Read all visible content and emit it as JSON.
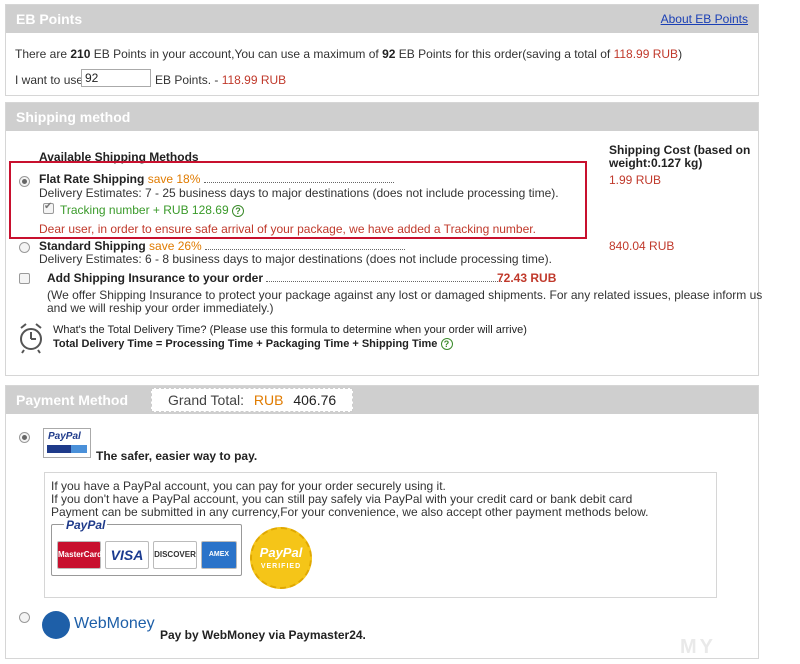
{
  "eb_points": {
    "title": "EB Points",
    "about_link": "About EB Points",
    "info_prefix": "There are ",
    "available": "210",
    "info_mid": " EB Points in your account,You can use a maximum of ",
    "max_use": "92",
    "info_mid2": " EB Points for this order(saving a total of ",
    "saving": "118.99 RUB",
    "info_end": ")",
    "use_label": "I want to use",
    "use_value": "92",
    "use_suffix": "EB Points. -",
    "use_discount": "118.99 RUB"
  },
  "shipping": {
    "title": "Shipping method",
    "col_methods": "Available Shipping Methods",
    "col_cost_1": "Shipping Cost (based on",
    "col_cost_2": "weight:0.127 kg)",
    "flat": {
      "name": "Flat Rate Shipping",
      "save": "save 18%",
      "estimate": "Delivery Estimates: 7 - 25 business days to major destinations (does not include processing time).",
      "tracking": "Tracking number + RUB 128.69",
      "notice": "Dear user, in order to ensure safe arrival of your package, we have added a Tracking number.",
      "cost": "1.99 RUB"
    },
    "standard": {
      "name": "Standard Shipping",
      "save": "save 26%",
      "estimate": "Delivery Estimates: 6 - 8 business days to major destinations (does not include processing time).",
      "cost": "840.04 RUB"
    },
    "insurance": {
      "label": "Add Shipping Insurance to your order",
      "cost": "72.43 RUB",
      "desc_1": "(We offer Shipping Insurance to protect your package against any lost or damaged shipments. For any related issues, please inform us",
      "desc_2": "and we will reship your order immediately.)"
    },
    "delivery_q": "What's the Total Delivery Time? (Please use this formula to determine when your order will arrive)",
    "delivery_formula": "Total Delivery Time = Processing Time + Packaging Time + Shipping Time"
  },
  "payment": {
    "title": "Payment Method",
    "grand_label": "Grand Total:",
    "grand_currency": "RUB",
    "grand_value": "406.76",
    "paypal_logo": "PayPal",
    "paypal_tagline": "The safer, easier way to pay.",
    "paypal_info_1": "If you have a PayPal account, you can pay for your order securely using it.",
    "paypal_info_2": "If you don't have a PayPal account, you can still pay safely via PayPal with your credit card or bank debit card",
    "paypal_info_3": "Payment can be submitted in any currency,For your convenience, we also accept other payment methods below.",
    "cards_label": "PayPal",
    "card_mastercard": "MasterCard",
    "card_visa": "VISA",
    "card_discover": "DISCOVER",
    "card_amex": "AMEX",
    "seal_top": "PayPal",
    "seal_bottom": "VERIFIED",
    "webmoney_logo": "WebMoney",
    "webmoney_desc": "Pay by WebMoney via Paymaster24."
  },
  "colors": {
    "accent_red": "#c8102e",
    "header_gray": "#cfcfcf",
    "link_blue": "#1a3fb5",
    "save_orange": "#e07b00"
  },
  "icons": [
    "help-icon",
    "alarm-clock-icon",
    "paypal-logo",
    "webmoney-globe-icon"
  ]
}
